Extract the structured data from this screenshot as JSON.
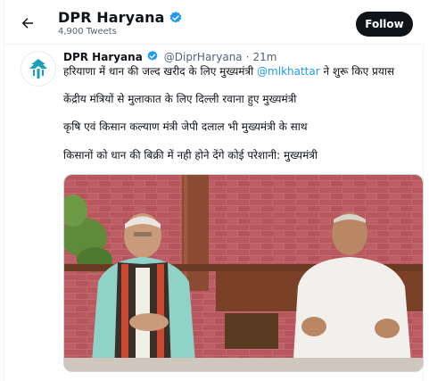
{
  "header": {
    "title": "DPR Haryana",
    "subtitle": "4,900 Tweets",
    "follow_label": "Follow"
  },
  "tweet": {
    "author_name": "DPR Haryana",
    "handle": "@DiprHaryana",
    "separator": "·",
    "time": "21m",
    "line1_prefix": "हरियाणा में धान की जल्द खरीद के लिए मुख्यमंत्री ",
    "line1_mention": "@mlkhattar",
    "line1_suffix": " ने शुरू किए प्रयास",
    "line2": "केंद्रीय मंत्रियों से मुलाकात के लिए दिल्ली रवाना हुए मुख्यमंत्री",
    "line3": "कृषि एवं किसान कल्याण मंत्री जेपी दलाल भी मुख्यमंत्री के साथ",
    "line4": "किसानों को धान की बिक्री में नही होने देंगे कोई परेशानी: मुख्यमंत्री"
  },
  "icons": {
    "back": "arrow-left-icon",
    "verified": "verified-badge-icon",
    "avatar_logo": "tree-logo-icon"
  },
  "colors": {
    "accent": "#1d9bf0",
    "follow_bg": "#0f1419",
    "muted_text": "#536471",
    "brick_wall": "#b5525a"
  }
}
